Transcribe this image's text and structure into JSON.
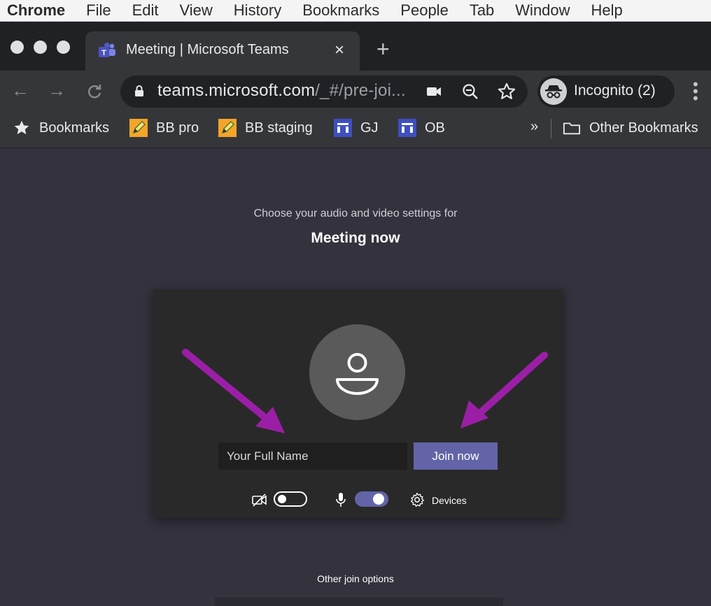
{
  "menubar": {
    "app": "Chrome",
    "items": [
      "File",
      "Edit",
      "View",
      "History",
      "Bookmarks",
      "People",
      "Tab",
      "Window",
      "Help"
    ]
  },
  "tab": {
    "title": "Meeting | Microsoft Teams",
    "close": "×",
    "new_tab": "+"
  },
  "toolbar": {
    "url_host": "teams.microsoft.com",
    "url_rest": "/_#/pre-joi...",
    "profile_label": "Incognito (2)"
  },
  "bookmarks": {
    "items": [
      {
        "label": "Bookmarks",
        "icon": "star-icon"
      },
      {
        "label": "BB pro",
        "icon": "pencil-icon"
      },
      {
        "label": "BB staging",
        "icon": "pencil-icon"
      },
      {
        "label": "GJ",
        "icon": "board-icon"
      },
      {
        "label": "OB",
        "icon": "board-icon"
      }
    ],
    "more": "»",
    "other": "Other Bookmarks"
  },
  "page": {
    "subtitle": "Choose your audio and video settings for",
    "meeting_title": "Meeting now",
    "name_placeholder": "Your Full Name",
    "join_label": "Join now",
    "devices_label": "Devices",
    "other_join": "Other join options",
    "camera_on": false,
    "mic_on": true
  },
  "colors": {
    "teams_purple": "#6264a7",
    "page_bg": "#33323d",
    "arrow": "#9b1fa6"
  }
}
